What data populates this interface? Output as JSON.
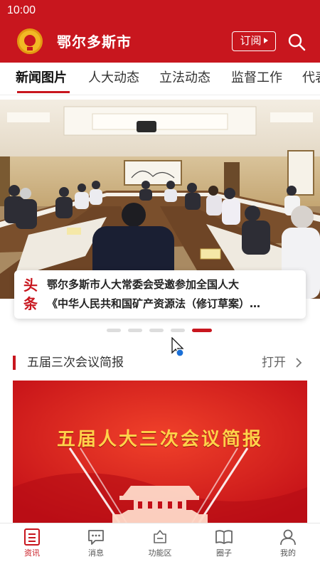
{
  "status_bar": {
    "time": "10:00"
  },
  "header": {
    "title": "鄂尔多斯市",
    "subscribe_label": "订阅"
  },
  "tabs": [
    {
      "label": "新闻图片",
      "active": true
    },
    {
      "label": "人大动态",
      "active": false
    },
    {
      "label": "立法动态",
      "active": false
    },
    {
      "label": "监督工作",
      "active": false
    },
    {
      "label": "代表",
      "active": false
    }
  ],
  "headline": {
    "badge_line1": "头",
    "badge_line2": "条",
    "line1": "鄂尔多斯市人大常委会受邀参加全国人大",
    "line2": "《中华人民共和国矿产资源法（修订草案）…"
  },
  "carousel": {
    "total": 5,
    "active_index": 4
  },
  "section": {
    "title": "五届三次会议简报",
    "open_label": "打开"
  },
  "bulletin": {
    "title": "五届人大三次会议简报"
  },
  "bottom_nav": [
    {
      "label": "资讯",
      "icon": "news-icon",
      "active": true
    },
    {
      "label": "消息",
      "icon": "message-icon",
      "active": false
    },
    {
      "label": "功能区",
      "icon": "function-area-icon",
      "active": false
    },
    {
      "label": "圈子",
      "icon": "circle-book-icon",
      "active": false
    },
    {
      "label": "我的",
      "icon": "profile-icon",
      "active": false
    }
  ],
  "colors": {
    "brand_red": "#c8161e",
    "bulletin_gold": "#ffd24a"
  }
}
